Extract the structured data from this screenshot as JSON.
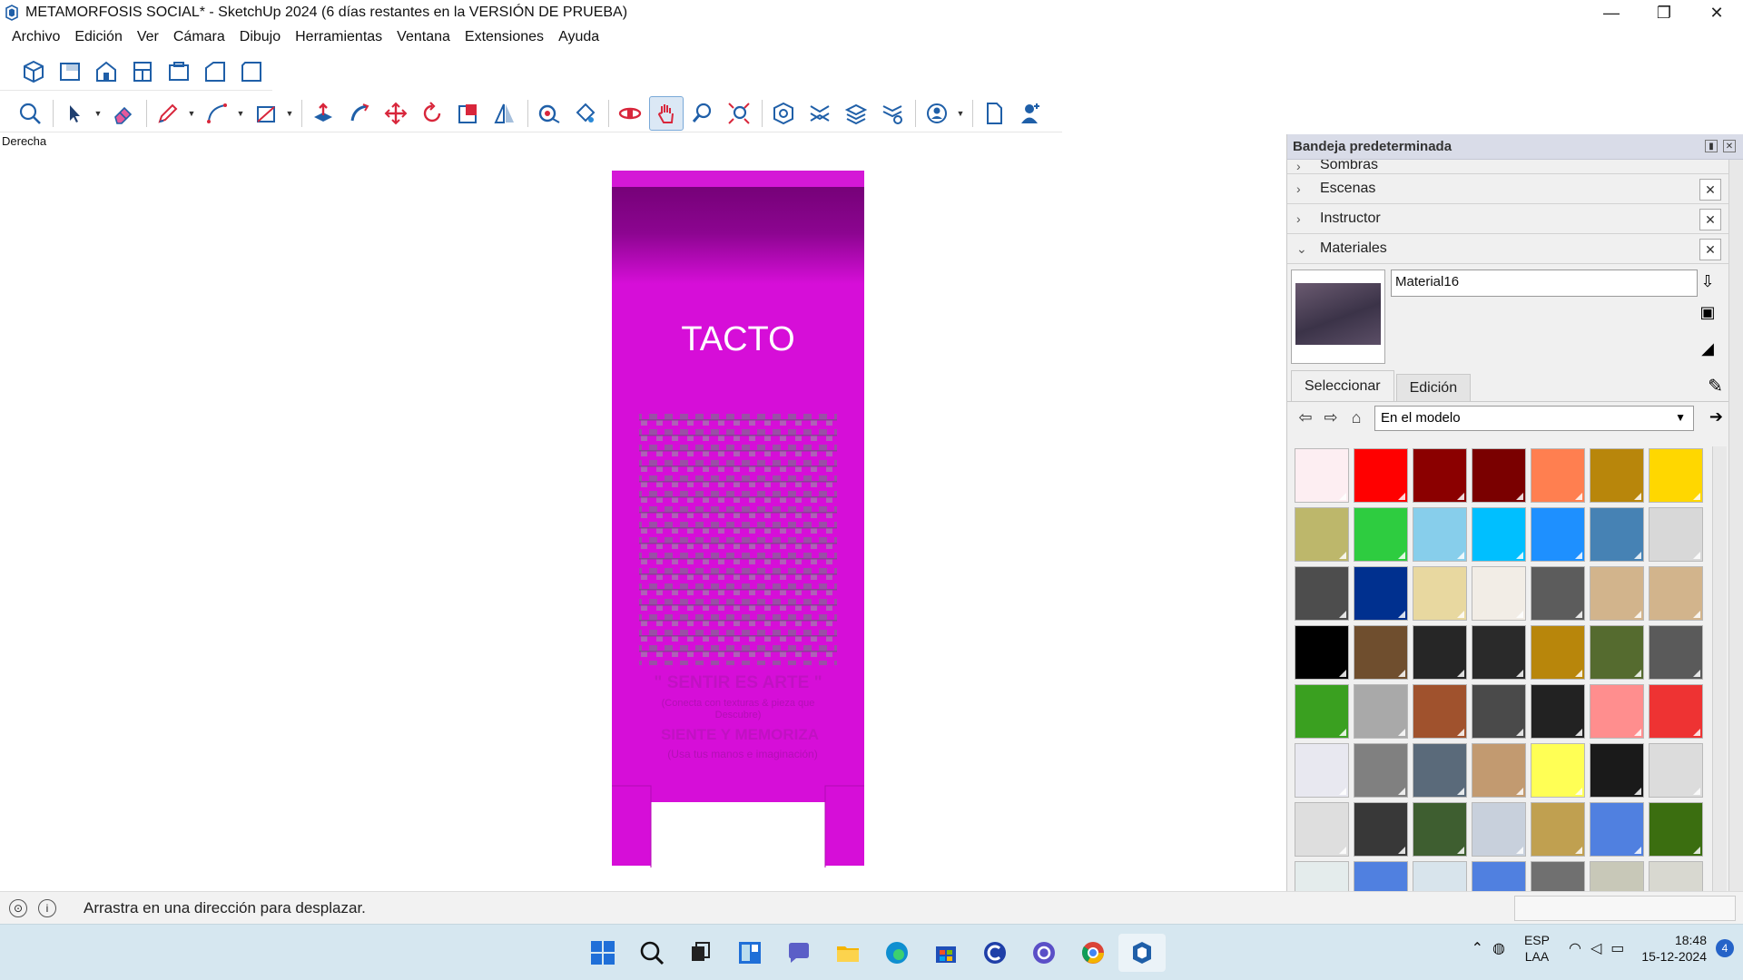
{
  "window": {
    "title": "METAMORFOSIS SOCIAL* - SketchUp 2024 (6 días restantes en la VERSIÓN DE PRUEBA)",
    "minimize": "—",
    "restore": "❐",
    "close": "✕"
  },
  "menu": [
    "Archivo",
    "Edición",
    "Ver",
    "Cámara",
    "Dibujo",
    "Herramientas",
    "Ventana",
    "Extensiones",
    "Ayuda"
  ],
  "viewport": {
    "view_name": "Derecha",
    "model": {
      "title_text": "TACTO",
      "line1": "\" SENTIR ES ARTE \"",
      "line2": "(Conecta con texturas & pieza que",
      "line3": "Descubre)",
      "line4": "SIENTE Y MEMORIZA",
      "line5": "(Usa tus manos e imaginación)",
      "colors": {
        "body": "#d60ed8",
        "top_band": "#6e0070",
        "pattern": "#a04fa8"
      }
    }
  },
  "status": {
    "message": "Arrastra en una dirección para desplazar."
  },
  "tray": {
    "title": "Bandeja predeterminada",
    "sections": [
      {
        "label": "Sombras",
        "expanded": false
      },
      {
        "label": "Escenas",
        "expanded": false
      },
      {
        "label": "Instructor",
        "expanded": false
      },
      {
        "label": "Materiales",
        "expanded": true
      }
    ],
    "material_name": "Material16",
    "tabs": [
      "Seleccionar",
      "Edición"
    ],
    "collection": "En el modelo",
    "swatches": [
      "#fdeef2",
      "#ff0000",
      "#8b0000",
      "#7a0000",
      "#ff7f50",
      "#b8860b",
      "#ffd700",
      "#bdb76b",
      "#2ecc40",
      "#87ceeb",
      "#00bfff",
      "#1e90ff",
      "#4682b4",
      "#d8d8d8",
      "#4d4d4d",
      "#00308f",
      "#e8d8a0",
      "#f2ede6",
      "#5c5c5c",
      "#d2b48c",
      "#d2b48c",
      "#000000",
      "#6f4e2e",
      "#262626",
      "#2a2a2a",
      "#b8860b",
      "#556b2f",
      "#5a5a5a",
      "#3aa020",
      "#a9a9a9",
      "#a0522d",
      "#4a4a4a",
      "#222222",
      "#ff8e8e",
      "#ee3333",
      "#e8e8f0",
      "#808080",
      "#5a6a7a",
      "#c29a70",
      "#ffff55",
      "#1a1a1a",
      "#dcdcdc",
      "#dedede",
      "#383838",
      "#3e5e30",
      "#c8d0dc",
      "#c0a050",
      "#5080e0",
      "#3b6e10",
      "#e4ecec",
      "#5080e0",
      "#d8e4ec",
      "#5080e0",
      "#707070",
      "#c8c8b8",
      "#d8d8d0"
    ]
  },
  "taskbar": {
    "lang_top": "ESP",
    "lang_bottom": "LAA",
    "time": "18:48",
    "date": "15-12-2024",
    "notifications": "4"
  }
}
